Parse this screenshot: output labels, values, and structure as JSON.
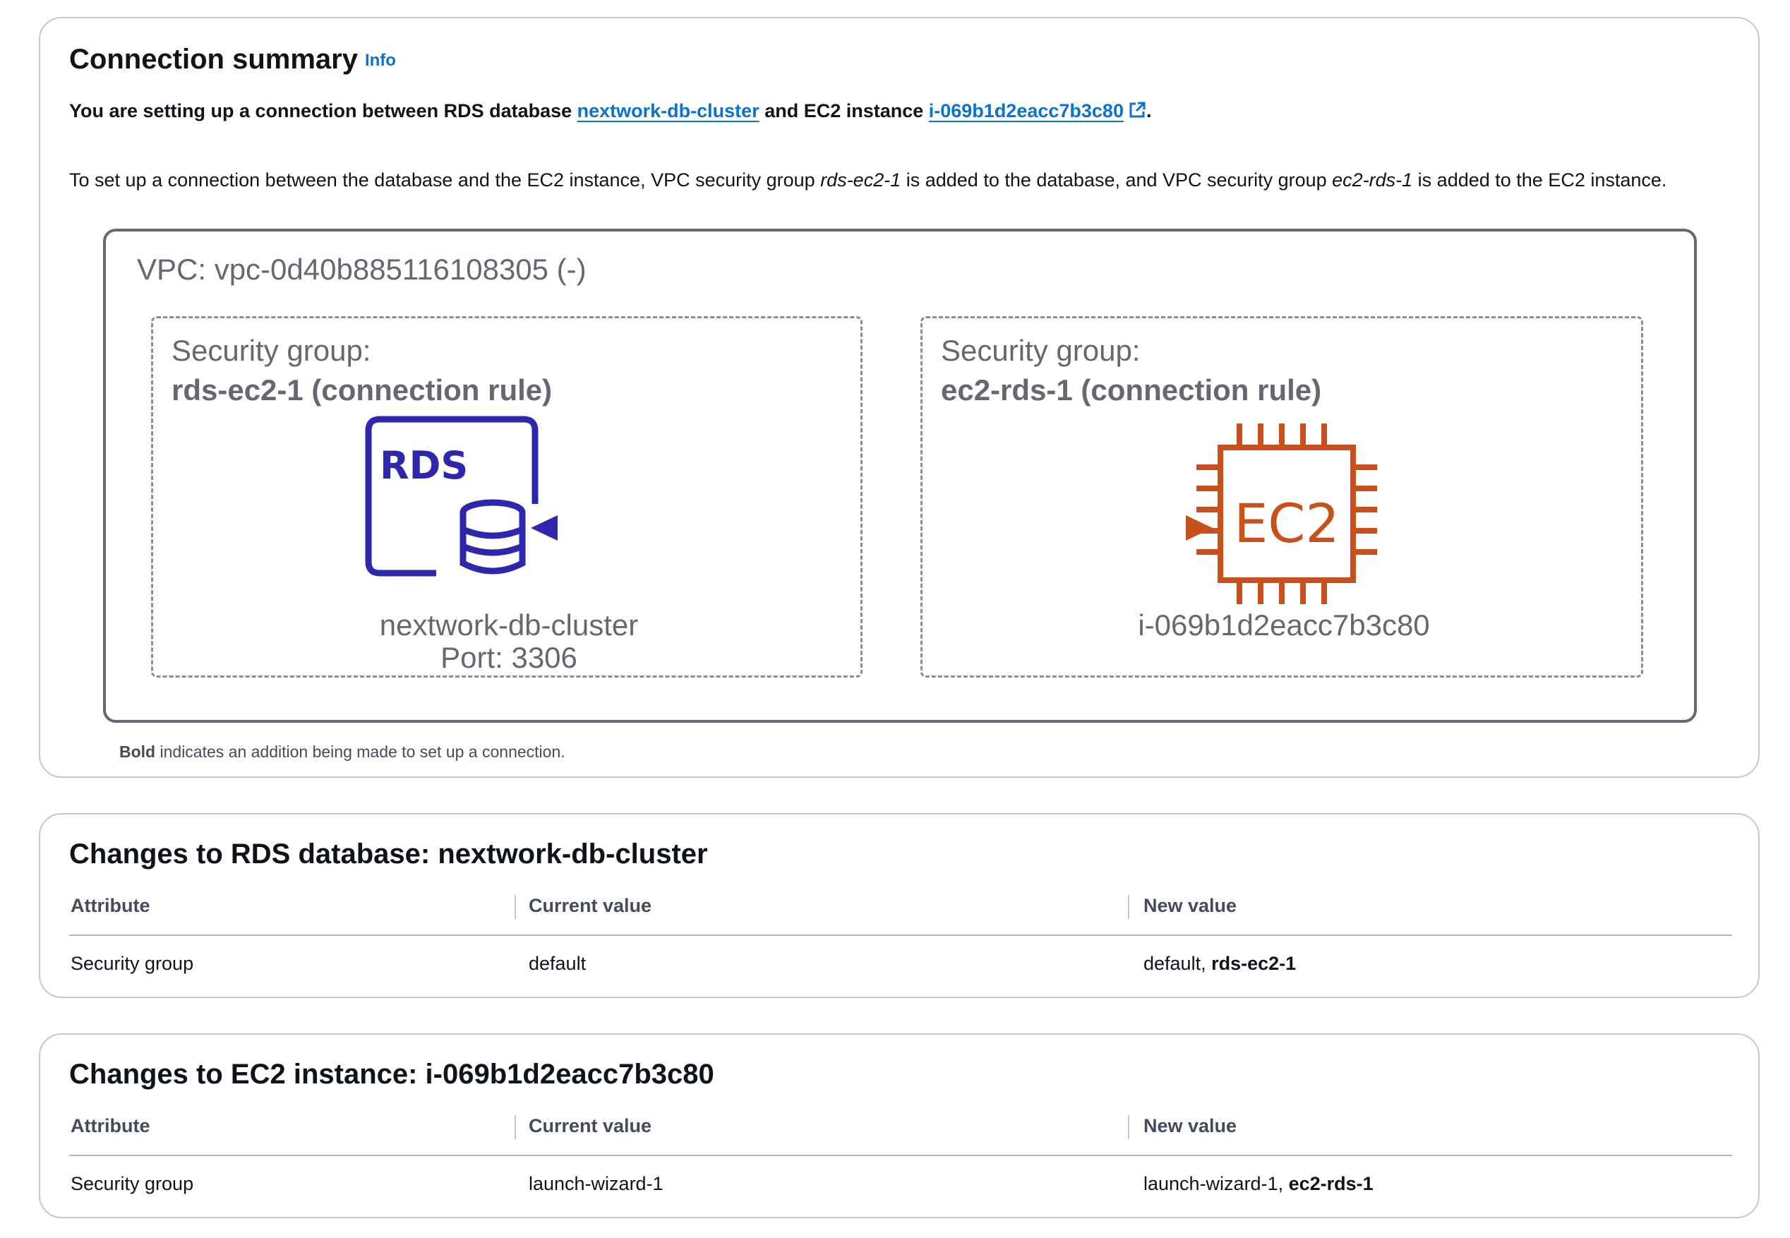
{
  "summary": {
    "title": "Connection summary",
    "info_label": "Info",
    "line_prefix": "You are setting up a connection between RDS database ",
    "db_link": "nextwork-db-cluster",
    "line_mid": " and EC2 instance ",
    "instance_link": "i-069b1d2eacc7b3c80",
    "line_suffix": ".",
    "explain_1": "To set up a connection between the database and the EC2 instance, VPC security group ",
    "explain_sg_rds": "rds-ec2-1",
    "explain_2": " is added to the database, and VPC security group ",
    "explain_sg_ec2": "ec2-rds-1",
    "explain_3": " is added to the EC2 instance.",
    "footnote_bold": "Bold",
    "footnote_rest": " indicates an addition being made to set up a connection."
  },
  "diagram": {
    "vpc_label": "VPC: vpc-0d40b885116108305 (-)",
    "rds_group": {
      "heading": "Security group:",
      "name": "rds-ec2-1 (connection rule)",
      "icon_text": "RDS",
      "node_name": "nextwork-db-cluster",
      "port": "Port: 3306"
    },
    "ec2_group": {
      "heading": "Security group:",
      "name": "ec2-rds-1 (connection rule)",
      "icon_text": "EC2",
      "node_name": "i-069b1d2eacc7b3c80"
    },
    "colors": {
      "rds": "#2e27ad",
      "ec2": "#c8511b",
      "muted": "#656871",
      "link": "#0972d3"
    }
  },
  "rds_changes": {
    "title": "Changes to RDS database: nextwork-db-cluster",
    "headers": [
      "Attribute",
      "Current value",
      "New value"
    ],
    "row": {
      "attribute": "Security group",
      "current": "default",
      "new_prefix": "default, ",
      "new_bold": "rds-ec2-1"
    }
  },
  "ec2_changes": {
    "title": "Changes to EC2 instance: i-069b1d2eacc7b3c80",
    "headers": [
      "Attribute",
      "Current value",
      "New value"
    ],
    "row": {
      "attribute": "Security group",
      "current": "launch-wizard-1",
      "new_prefix": "launch-wizard-1, ",
      "new_bold": "ec2-rds-1"
    }
  }
}
